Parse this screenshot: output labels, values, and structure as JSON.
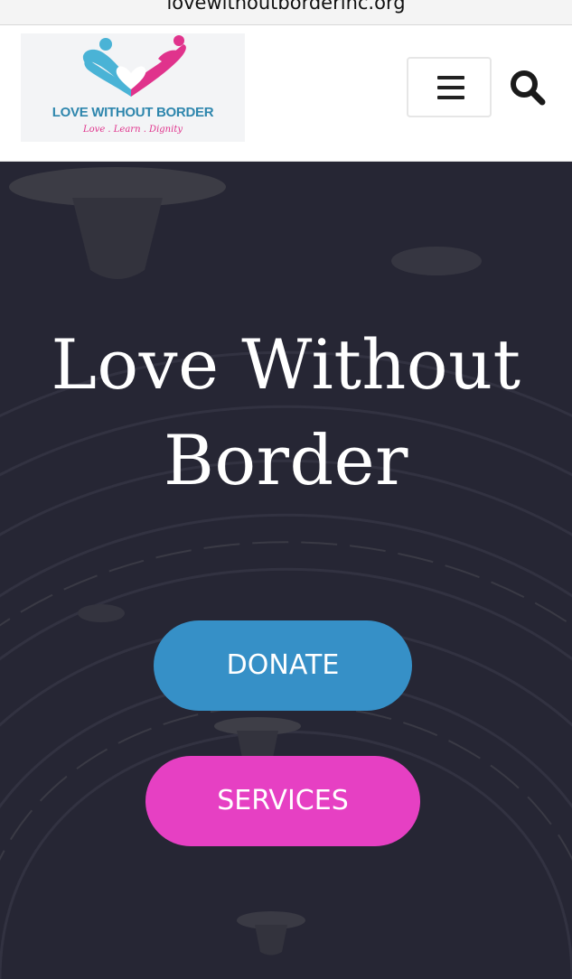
{
  "browser": {
    "url": "lovewithoutborderinc.org"
  },
  "header": {
    "logo": {
      "name": "LOVE WITHOUT BORDER",
      "tagline": "Love . Learn . Dignity"
    },
    "menu_icon": "hamburger-menu-icon",
    "search_icon": "search-icon"
  },
  "hero": {
    "title_line1": "Love Without",
    "title_line2": "Border",
    "donate_label": "DONATE",
    "services_label": "SERVICES"
  },
  "colors": {
    "donate": "#3690c7",
    "services": "#e640c3",
    "hero_bg": "#2a2a38",
    "logo_blue": "#2e86ad",
    "logo_pink": "#e0338c"
  }
}
